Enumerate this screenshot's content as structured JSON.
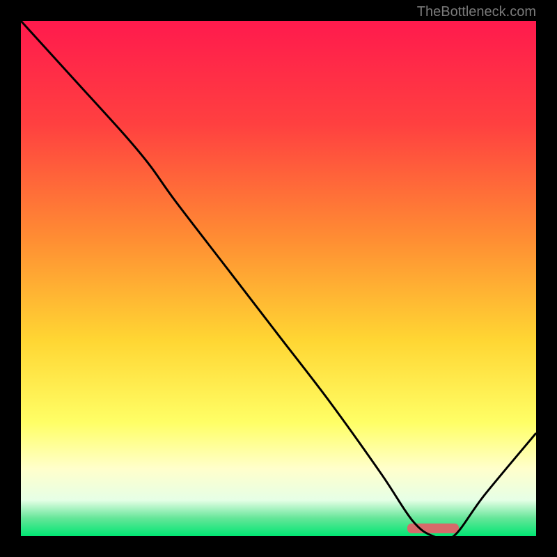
{
  "attribution": "TheBottleneck.com",
  "colors": {
    "gradient_top": "#ff1a4d",
    "gradient_mid_orange": "#ff7a33",
    "gradient_yellow": "#ffe633",
    "gradient_pale_yellow": "#ffffb0",
    "gradient_mint": "#f2ffe6",
    "gradient_green": "#00cc66",
    "gradient_bottom_green": "#00e673",
    "curve": "#000000",
    "optimal_bar": "#d66a6a"
  },
  "chart_data": {
    "type": "line",
    "title": "",
    "xlabel": "",
    "ylabel": "",
    "xlim": [
      0,
      100
    ],
    "ylim": [
      0,
      100
    ],
    "series": [
      {
        "name": "bottleneck-curve",
        "x": [
          0,
          10,
          20,
          25,
          30,
          40,
          50,
          60,
          70,
          76,
          80,
          84,
          90,
          100
        ],
        "y": [
          100,
          89,
          78,
          72,
          65,
          52,
          39,
          26,
          12,
          3,
          0,
          0,
          8,
          20
        ]
      }
    ],
    "optimal_range": {
      "x_start": 75,
      "x_end": 85,
      "y": 1.5
    },
    "gradient_stops": [
      {
        "offset": 0.0,
        "color": "#ff1a4d"
      },
      {
        "offset": 0.2,
        "color": "#ff4040"
      },
      {
        "offset": 0.42,
        "color": "#ff8c33"
      },
      {
        "offset": 0.62,
        "color": "#ffd633"
      },
      {
        "offset": 0.78,
        "color": "#ffff66"
      },
      {
        "offset": 0.87,
        "color": "#ffffcc"
      },
      {
        "offset": 0.93,
        "color": "#e6ffe6"
      },
      {
        "offset": 0.965,
        "color": "#66e699"
      },
      {
        "offset": 1.0,
        "color": "#00e673"
      }
    ]
  }
}
